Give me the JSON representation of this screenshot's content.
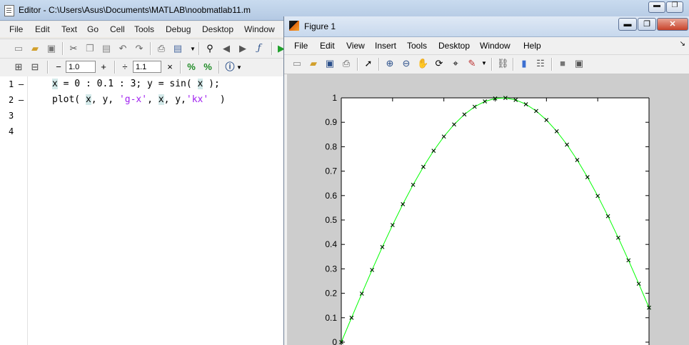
{
  "editor": {
    "title": "Editor - C:\\Users\\Asus\\Documents\\MATLAB\\noobmatlab11.m",
    "menu": [
      "File",
      "Edit",
      "Text",
      "Go",
      "Cell",
      "Tools",
      "Debug",
      "Desktop",
      "Window"
    ],
    "cell_toolbar": {
      "decrement_label": "−",
      "value1": "1.0",
      "increment_label": "+",
      "divide_label": "÷",
      "value2": "1.1",
      "multiply_label": "×"
    },
    "line_numbers": [
      "1",
      "2",
      "3",
      "4"
    ],
    "line_markers": [
      "–",
      "–"
    ],
    "code": {
      "line1": {
        "a": "x",
        "b": " = 0 : 0.1 : 3; y = sin( ",
        "c": "x",
        "d": " );"
      },
      "line2": {
        "a": "plot( ",
        "b": "x",
        "c": ", y, ",
        "d": "'g-x'",
        "e": ", ",
        "f": "x",
        "g": ", y,",
        "h": "'kx'",
        "i": "  )"
      }
    }
  },
  "figure": {
    "title": "Figure 1",
    "menu": [
      "File",
      "Edit",
      "View",
      "Insert",
      "Tools",
      "Desktop",
      "Window",
      "Help"
    ],
    "dock_arrow": "↘"
  },
  "chart_data": {
    "type": "line",
    "title": "",
    "xlabel": "",
    "ylabel": "",
    "xlim": [
      0,
      3
    ],
    "ylim": [
      0,
      1
    ],
    "yticks": [
      "0",
      "0.1",
      "0.2",
      "0.3",
      "0.4",
      "0.5",
      "0.6",
      "0.7",
      "0.8",
      "0.9",
      "1"
    ],
    "x": [
      0,
      0.1,
      0.2,
      0.3,
      0.4,
      0.5,
      0.6,
      0.7,
      0.8,
      0.9,
      1.0,
      1.1,
      1.2,
      1.3,
      1.4,
      1.5,
      1.6,
      1.7,
      1.8,
      1.9,
      2.0,
      2.1,
      2.2,
      2.3,
      2.4,
      2.5,
      2.6,
      2.7,
      2.8,
      2.9,
      3.0
    ],
    "series": [
      {
        "style": "g-x",
        "color": "#00ff00",
        "values": [
          0,
          0.0998,
          0.1987,
          0.2955,
          0.3894,
          0.4794,
          0.5646,
          0.6442,
          0.7174,
          0.7833,
          0.8415,
          0.8912,
          0.932,
          0.9636,
          0.9854,
          0.9975,
          0.9996,
          0.9917,
          0.9738,
          0.9463,
          0.9093,
          0.8632,
          0.8085,
          0.7457,
          0.6755,
          0.5985,
          0.5155,
          0.4274,
          0.335,
          0.2392,
          0.1411
        ]
      },
      {
        "style": "kx",
        "color": "#000000",
        "values": [
          0,
          0.0998,
          0.1987,
          0.2955,
          0.3894,
          0.4794,
          0.5646,
          0.6442,
          0.7174,
          0.7833,
          0.8415,
          0.8912,
          0.932,
          0.9636,
          0.9854,
          0.9975,
          0.9996,
          0.9917,
          0.9738,
          0.9463,
          0.9093,
          0.8632,
          0.8085,
          0.7457,
          0.6755,
          0.5985,
          0.5155,
          0.4274,
          0.335,
          0.2392,
          0.1411
        ]
      }
    ],
    "grid": false,
    "legend": "none"
  }
}
